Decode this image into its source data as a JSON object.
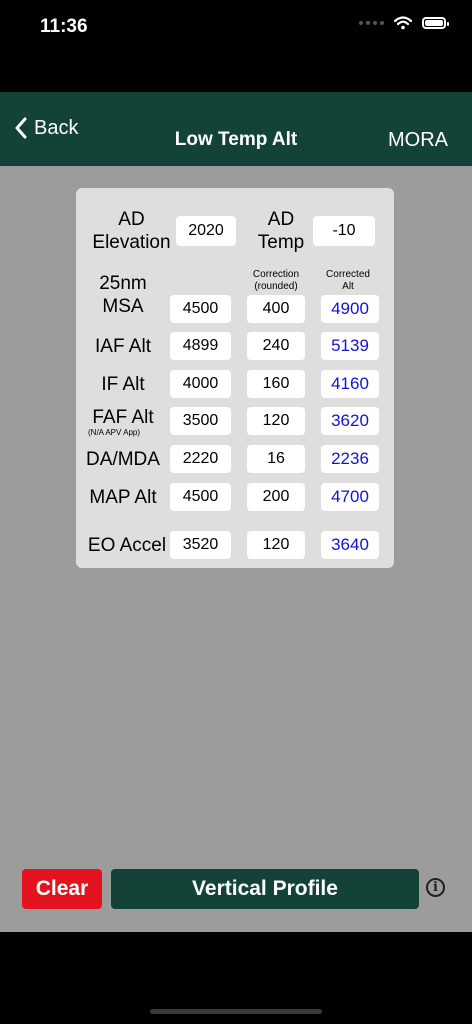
{
  "status": {
    "time": "11:36"
  },
  "nav": {
    "back_label": "Back",
    "title": "Low Temp Alt",
    "right_label": "MORA"
  },
  "top": {
    "ad_elevation_label": "AD\nElevation",
    "ad_elevation_value": "2020",
    "ad_temp_label": "AD\nTemp",
    "ad_temp_value": "-10"
  },
  "headers": {
    "correction": "Correction\n(rounded)",
    "corrected": "Corrected\nAlt"
  },
  "rows": [
    {
      "label": "25nm\nMSA",
      "alt": "4500",
      "correction": "400",
      "corrected": "4900"
    },
    {
      "label": "IAF Alt",
      "alt": "4899",
      "correction": "240",
      "corrected": "5139"
    },
    {
      "label": "IF Alt",
      "alt": "4000",
      "correction": "160",
      "corrected": "4160"
    },
    {
      "label": "FAF Alt",
      "sublabel": "(N/A APV App)",
      "alt": "3500",
      "correction": "120",
      "corrected": "3620"
    },
    {
      "label": "DA/MDA",
      "alt": "2220",
      "correction": "16",
      "corrected": "2236"
    },
    {
      "label": "MAP Alt",
      "alt": "4500",
      "correction": "200",
      "corrected": "4700"
    },
    {
      "label": "EO Accel",
      "alt": "3520",
      "correction": "120",
      "corrected": "3640"
    }
  ],
  "buttons": {
    "clear": "Clear",
    "vertical_profile": "Vertical Profile",
    "info": "i"
  },
  "colors": {
    "nav_green": "#134338",
    "clear_red": "#e3141f",
    "corrected_blue": "#1313d6",
    "screen_gray": "#9c9c9c",
    "card_gray": "#dedede"
  }
}
